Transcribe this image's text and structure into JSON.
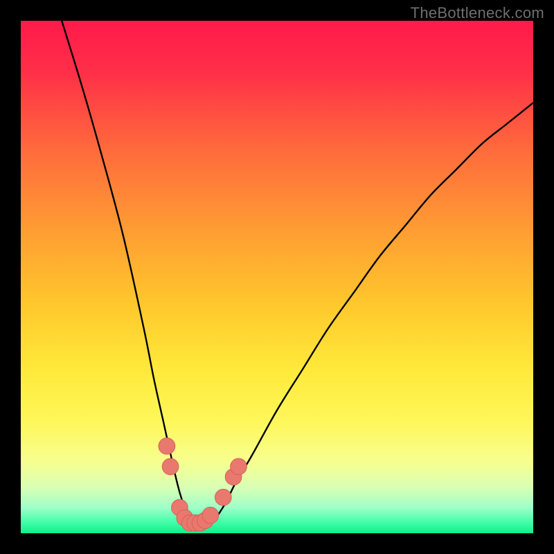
{
  "watermark": "TheBottleneck.com",
  "colors": {
    "frame": "#000000",
    "gradient_stops": [
      {
        "offset": 0.0,
        "color": "#ff1a4b"
      },
      {
        "offset": 0.1,
        "color": "#ff2f48"
      },
      {
        "offset": 0.25,
        "color": "#ff6a3c"
      },
      {
        "offset": 0.4,
        "color": "#ff9a33"
      },
      {
        "offset": 0.55,
        "color": "#ffc72c"
      },
      {
        "offset": 0.68,
        "color": "#ffe93a"
      },
      {
        "offset": 0.78,
        "color": "#fef759"
      },
      {
        "offset": 0.86,
        "color": "#f7ff8e"
      },
      {
        "offset": 0.91,
        "color": "#d9ffb4"
      },
      {
        "offset": 0.95,
        "color": "#9fffc9"
      },
      {
        "offset": 0.975,
        "color": "#4dffad"
      },
      {
        "offset": 1.0,
        "color": "#0df08a"
      }
    ],
    "curve": "#000000",
    "marker_fill": "#e9796f",
    "marker_stroke": "#d65f56"
  },
  "chart_data": {
    "type": "line",
    "title": "",
    "xlabel": "",
    "ylabel": "",
    "xlim": [
      0,
      100
    ],
    "ylim": [
      0,
      100
    ],
    "series": [
      {
        "name": "bottleneck-curve",
        "x": [
          8,
          12,
          16,
          20,
          24,
          26,
          28,
          30,
          31,
          32,
          33,
          34,
          35,
          36,
          38,
          40,
          42,
          45,
          50,
          55,
          60,
          65,
          70,
          75,
          80,
          85,
          90,
          95,
          100
        ],
        "y": [
          100,
          87,
          73,
          58,
          40,
          30,
          21,
          12,
          8,
          5,
          3,
          2,
          2,
          2,
          3,
          6,
          10,
          15,
          24,
          32,
          40,
          47,
          54,
          60,
          66,
          71,
          76,
          80,
          84
        ]
      }
    ],
    "markers": [
      {
        "x": 28.5,
        "y": 17
      },
      {
        "x": 29.2,
        "y": 13
      },
      {
        "x": 31.0,
        "y": 5
      },
      {
        "x": 32.0,
        "y": 3
      },
      {
        "x": 33.0,
        "y": 2
      },
      {
        "x": 34.0,
        "y": 2
      },
      {
        "x": 35.0,
        "y": 2
      },
      {
        "x": 36.0,
        "y": 2.5
      },
      {
        "x": 37.0,
        "y": 3.5
      },
      {
        "x": 39.5,
        "y": 7
      },
      {
        "x": 41.5,
        "y": 11
      },
      {
        "x": 42.5,
        "y": 13
      }
    ],
    "marker_radius": 1.6
  }
}
